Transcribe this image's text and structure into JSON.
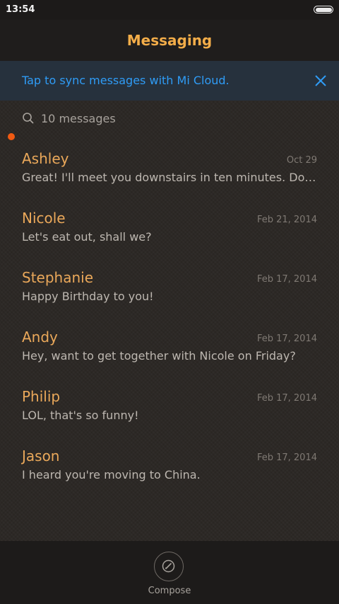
{
  "status_bar": {
    "time": "13:54"
  },
  "header": {
    "title": "Messaging"
  },
  "sync_banner": {
    "text": "Tap to sync messages with Mi Cloud."
  },
  "search": {
    "count_text": "10 messages"
  },
  "conversations": [
    {
      "name": "Ashley",
      "date": "Oct 29",
      "preview": "Great! I'll meet you downstairs in ten minutes. Don't forget to bring the tickets.",
      "unread": false
    },
    {
      "name": "Nicole",
      "date": "Feb 21, 2014",
      "preview": "Let's eat out, shall we?",
      "unread": false
    },
    {
      "name": "Stephanie",
      "date": "Feb 17, 2014",
      "preview": "Happy Birthday to you!",
      "unread": true
    },
    {
      "name": "Andy",
      "date": "Feb 17, 2014",
      "preview": "Hey, want to get together with Nicole on Friday?",
      "unread": false
    },
    {
      "name": "Philip",
      "date": "Feb 17, 2014",
      "preview": "LOL, that's so funny!",
      "unread": false
    },
    {
      "name": "Jason",
      "date": "Feb 17, 2014",
      "preview": "I heard you're moving to China.",
      "unread": false
    }
  ],
  "bottom_bar": {
    "compose_label": "Compose",
    "compose_icon": "pencil-circle-icon"
  },
  "colors": {
    "accent": "#f3ad49",
    "link_blue": "#2f9cf6",
    "unread_dot": "#f05a12"
  }
}
